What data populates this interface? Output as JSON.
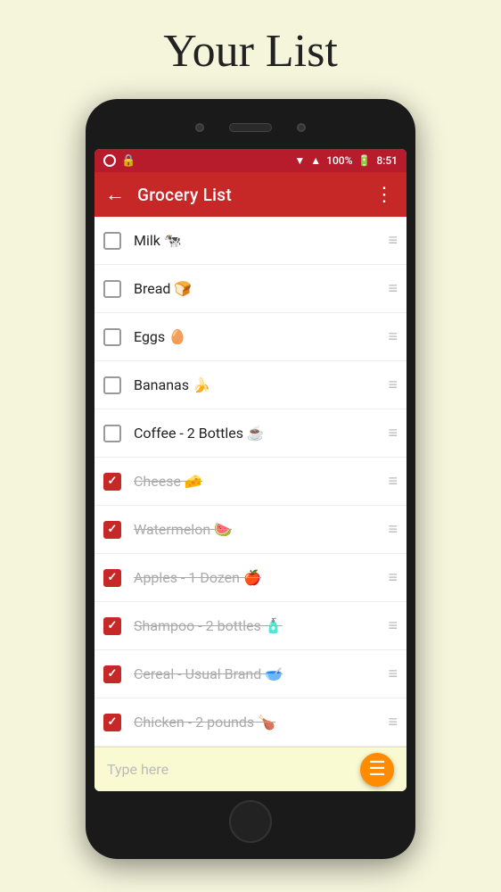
{
  "page": {
    "title": "Your List"
  },
  "status_bar": {
    "battery": "100%",
    "time": "8:51"
  },
  "toolbar": {
    "title": "Grocery List",
    "back_icon": "←",
    "more_icon": "⋮"
  },
  "items": [
    {
      "id": 1,
      "label": "Milk 🐄",
      "checked": false,
      "strikethrough": false
    },
    {
      "id": 2,
      "label": "Bread 🍞",
      "checked": false,
      "strikethrough": false
    },
    {
      "id": 3,
      "label": "Eggs 🥚",
      "checked": false,
      "strikethrough": false
    },
    {
      "id": 4,
      "label": "Bananas 🍌",
      "checked": false,
      "strikethrough": false
    },
    {
      "id": 5,
      "label": "Coffee - 2 Bottles ☕",
      "checked": false,
      "strikethrough": false
    },
    {
      "id": 6,
      "label": "Cheese 🧀",
      "checked": true,
      "strikethrough": true
    },
    {
      "id": 7,
      "label": "Watermelon 🍉",
      "checked": true,
      "strikethrough": true
    },
    {
      "id": 8,
      "label": "Apples - 1 Dozen 🍎",
      "checked": true,
      "strikethrough": true
    },
    {
      "id": 9,
      "label": "Shampoo - 2 bottles 🧴",
      "checked": true,
      "strikethrough": true
    },
    {
      "id": 10,
      "label": "Cereal - Usual Brand 🥣",
      "checked": true,
      "strikethrough": true
    },
    {
      "id": 11,
      "label": "Chicken - 2 pounds 🍗",
      "checked": true,
      "strikethrough": true
    }
  ],
  "bottom_bar": {
    "placeholder": "Type here",
    "fab_icon": "☰"
  }
}
